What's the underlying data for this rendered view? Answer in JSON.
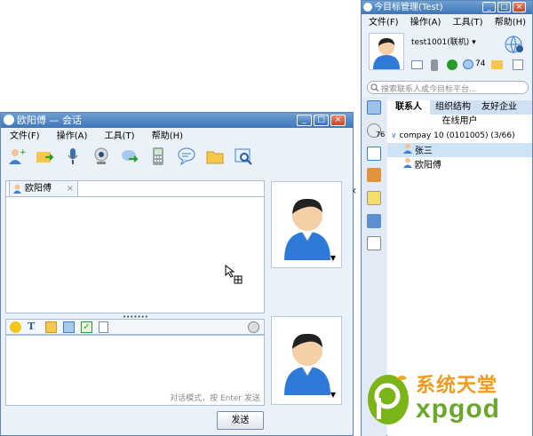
{
  "chat": {
    "title": "欧阳傅 — 会话",
    "menu": [
      "文件(F)",
      "操作(A)",
      "工具(T)",
      "帮助(H)"
    ],
    "tab_label": "欧阳傅",
    "tab_close": "×",
    "hint": "对话模式，按 Enter 发送",
    "send_label": "发送",
    "collapse_arrow": "‹",
    "resize_grip": "•••••••",
    "caret": "▼",
    "toolbar_icons": [
      "add-contact-icon",
      "send-file-icon",
      "microphone-icon",
      "webcam-icon",
      "transfer-icon",
      "phone-icon",
      "speech-bubble-icon",
      "folder-icon",
      "search-window-icon"
    ],
    "format_icons": [
      "emoticon-icon",
      "font-icon",
      "image-icon",
      "screenshot-icon",
      "checkbox-icon",
      "clipboard-icon"
    ]
  },
  "main": {
    "title": "今目标管理(Test)",
    "menu": [
      "文件(F)",
      "操作(A)",
      "工具(T)",
      "帮助(H)"
    ],
    "user": "test1001(联机) ▾",
    "badge_count": "74",
    "side_badge": "76",
    "search_placeholder": "搜索联系人或今目标平台...",
    "tabs": [
      "联系人",
      "组织结构",
      "友好企业"
    ],
    "online_header": "在线用户",
    "group_line": "compay  10  (0101005) (3/66)",
    "contacts": [
      "张三",
      "欧阳傅"
    ]
  },
  "watermark": {
    "text_cn": "系统天堂",
    "text_en": "xpgod"
  },
  "colors": {
    "title_blue": "#3e76b8",
    "accent_orange": "#f5a623",
    "accent_green": "#7cb518",
    "selected": "#cfe3f6"
  }
}
